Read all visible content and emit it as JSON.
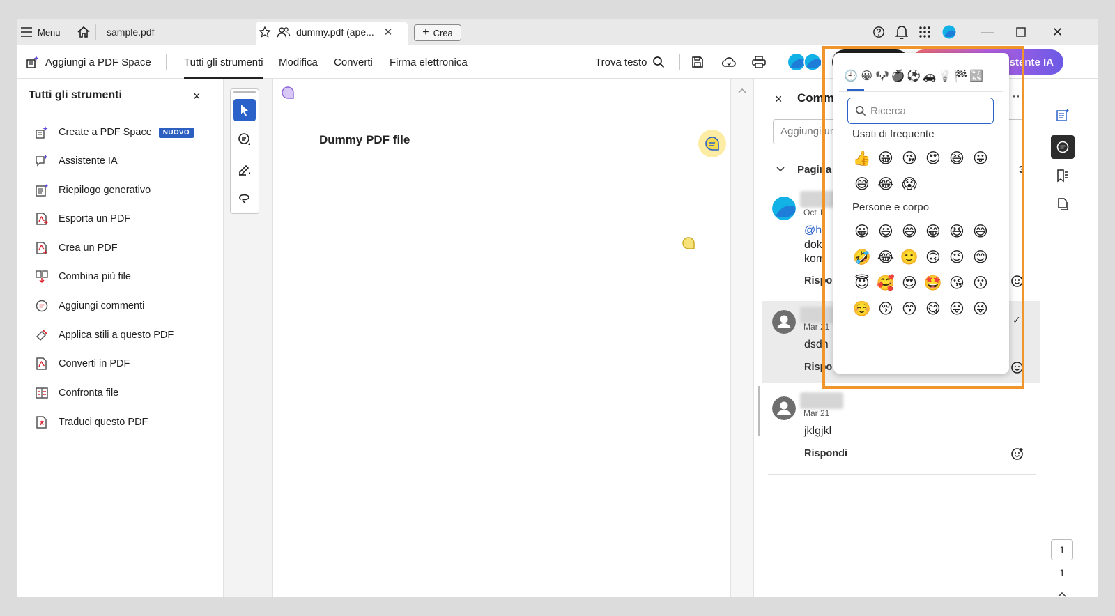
{
  "titlebar": {
    "menu_label": "Menu",
    "tab1": "sample.pdf",
    "tab2": "dummy.pdf (ape...",
    "create_label": "Crea"
  },
  "toolbar": {
    "add_space": "Aggiungi a PDF Space",
    "tabs": [
      "Tutti gli strumenti",
      "Modifica",
      "Converti",
      "Firma elettronica"
    ],
    "find_text": "Trova testo",
    "ai_label": "stente IA"
  },
  "left_panel": {
    "title": "Tutti gli strumenti",
    "items": [
      {
        "label": "Create a PDF Space",
        "badge": "NUOVO"
      },
      {
        "label": "Assistente IA"
      },
      {
        "label": "Riepilogo generativo"
      },
      {
        "label": "Esporta un PDF"
      },
      {
        "label": "Crea un PDF"
      },
      {
        "label": "Combina più file"
      },
      {
        "label": "Aggiungi commenti"
      },
      {
        "label": "Applica stili a questo PDF"
      },
      {
        "label": "Converti in PDF"
      },
      {
        "label": "Confronta file"
      },
      {
        "label": "Traduci questo PDF"
      }
    ]
  },
  "document": {
    "title": "Dummy PDF file"
  },
  "comments": {
    "header": "Comm",
    "add_placeholder": "Aggiungi un",
    "page_label": "Pagina",
    "page_count_partial": "3",
    "items": [
      {
        "date": "Oct 1",
        "mention": "@h",
        "lines": [
          "dok",
          "kom"
        ],
        "reply": "Rispo"
      },
      {
        "date": "Mar 21",
        "text": "dsdh",
        "reply": "Rispo"
      },
      {
        "date": "Mar 21",
        "text": "jklgjkl",
        "reply": "Rispondi"
      }
    ]
  },
  "rail": {
    "page_box": "1",
    "page_total": "1"
  },
  "emoji_picker": {
    "search_placeholder": "Ricerca",
    "categories": [
      "🕘",
      "😀",
      "🐶",
      "🍎",
      "⚽",
      "🚗",
      "💡",
      "🏁",
      "🔣"
    ],
    "sections": [
      {
        "title": "Usati di frequente",
        "rows": [
          [
            "👍",
            "😀",
            "😘",
            "😍",
            "😆",
            "😛"
          ],
          [
            "😅",
            "😂",
            "😱"
          ]
        ]
      },
      {
        "title": "Persone e corpo",
        "rows": [
          [
            "😀",
            "😃",
            "😄",
            "😁",
            "😆",
            "😅"
          ],
          [
            "🤣",
            "😂",
            "🙂",
            "🙃",
            "😉",
            "😊"
          ],
          [
            "😇",
            "🥰",
            "😍",
            "🤩",
            "😘",
            "😗"
          ],
          [
            "☺️",
            "😚",
            "😙",
            "😋",
            "😛",
            "😜"
          ]
        ]
      }
    ]
  }
}
